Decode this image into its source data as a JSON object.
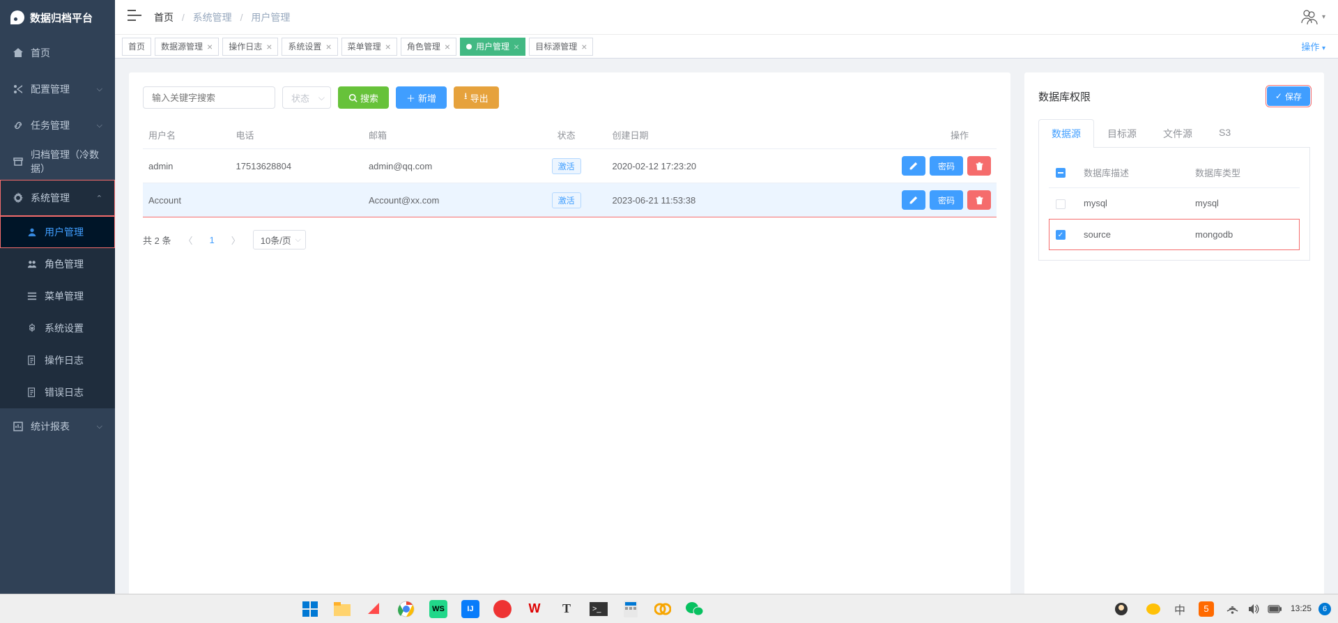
{
  "app": {
    "name": "数据归档平台"
  },
  "breadcrumb": {
    "root": "首页",
    "l1": "系统管理",
    "l2": "用户管理"
  },
  "sidebar": {
    "items": [
      {
        "label": "首页",
        "icon": "home"
      },
      {
        "label": "配置管理",
        "icon": "scissors",
        "expand": true
      },
      {
        "label": "任务管理",
        "icon": "link",
        "expand": true
      },
      {
        "label": "归档管理（冷数据）",
        "icon": "archive"
      },
      {
        "label": "系统管理",
        "icon": "gear",
        "expand": true,
        "active": true,
        "children": [
          {
            "label": "用户管理",
            "icon": "user",
            "active": true
          },
          {
            "label": "角色管理",
            "icon": "role"
          },
          {
            "label": "菜单管理",
            "icon": "menu"
          },
          {
            "label": "系统设置",
            "icon": "gear"
          },
          {
            "label": "操作日志",
            "icon": "log"
          },
          {
            "label": "错误日志",
            "icon": "log"
          }
        ]
      },
      {
        "label": "统计报表",
        "icon": "chart",
        "expand": true
      }
    ]
  },
  "tabs": {
    "items": [
      {
        "label": "首页",
        "closable": false
      },
      {
        "label": "数据源管理",
        "closable": true
      },
      {
        "label": "操作日志",
        "closable": true
      },
      {
        "label": "系统设置",
        "closable": true
      },
      {
        "label": "菜单管理",
        "closable": true
      },
      {
        "label": "角色管理",
        "closable": true
      },
      {
        "label": "用户管理",
        "closable": true,
        "active": true
      },
      {
        "label": "目标源管理",
        "closable": true
      }
    ],
    "ops_label": "操作"
  },
  "toolbar": {
    "search_placeholder": "输入关键字搜索",
    "status_placeholder": "状态",
    "search_btn": "搜索",
    "add_btn": "新增",
    "export_btn": "导出"
  },
  "users": {
    "columns": {
      "username": "用户名",
      "phone": "电话",
      "email": "邮箱",
      "status": "状态",
      "created": "创建日期",
      "ops": "操作"
    },
    "rows": [
      {
        "username": "admin",
        "phone": "17513628804",
        "email": "admin@qq.com",
        "status": "激活",
        "created": "2020-02-12 17:23:20",
        "selected": false
      },
      {
        "username": "Account",
        "phone": "",
        "email": "Account@xx.com",
        "status": "激活",
        "created": "2023-06-21 11:53:38",
        "selected": true
      }
    ],
    "row_ops": {
      "password": "密码"
    }
  },
  "pagination": {
    "total_text": "共 2 条",
    "current": "1",
    "page_size": "10条/页"
  },
  "perm_panel": {
    "title": "数据库权限",
    "save_btn": "保存",
    "tabs": [
      {
        "label": "数据源",
        "active": true
      },
      {
        "label": "目标源"
      },
      {
        "label": "文件源"
      },
      {
        "label": "S3"
      }
    ],
    "columns": {
      "desc": "数据库描述",
      "type": "数据库类型"
    },
    "rows": [
      {
        "desc": "mysql",
        "type": "mysql",
        "checked": false
      },
      {
        "desc": "source",
        "type": "mongodb",
        "checked": true
      }
    ]
  },
  "taskbar": {
    "time": "13:25",
    "badge": "6"
  }
}
